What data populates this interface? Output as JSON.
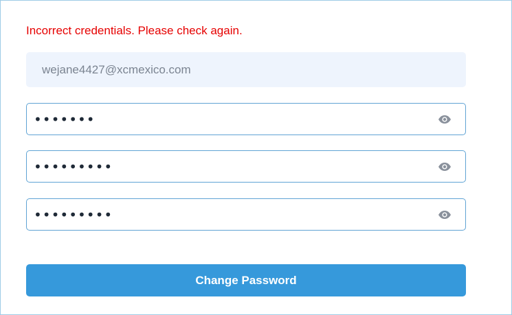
{
  "form": {
    "error_message": "Incorrect credentials. Please check again.",
    "email_value": "wejane4427@xcmexico.com",
    "current_password_masked": "•••••••",
    "new_password_masked": "•••••••••",
    "confirm_password_masked": "•••••••••",
    "submit_label": "Change Password",
    "show_password_icon": "eye-icon"
  },
  "colors": {
    "error": "#e60000",
    "button": "#3699db",
    "field_border": "#5fa3d4",
    "readonly_background": "#eef4fd",
    "frame_border": "#9ecbe6"
  }
}
